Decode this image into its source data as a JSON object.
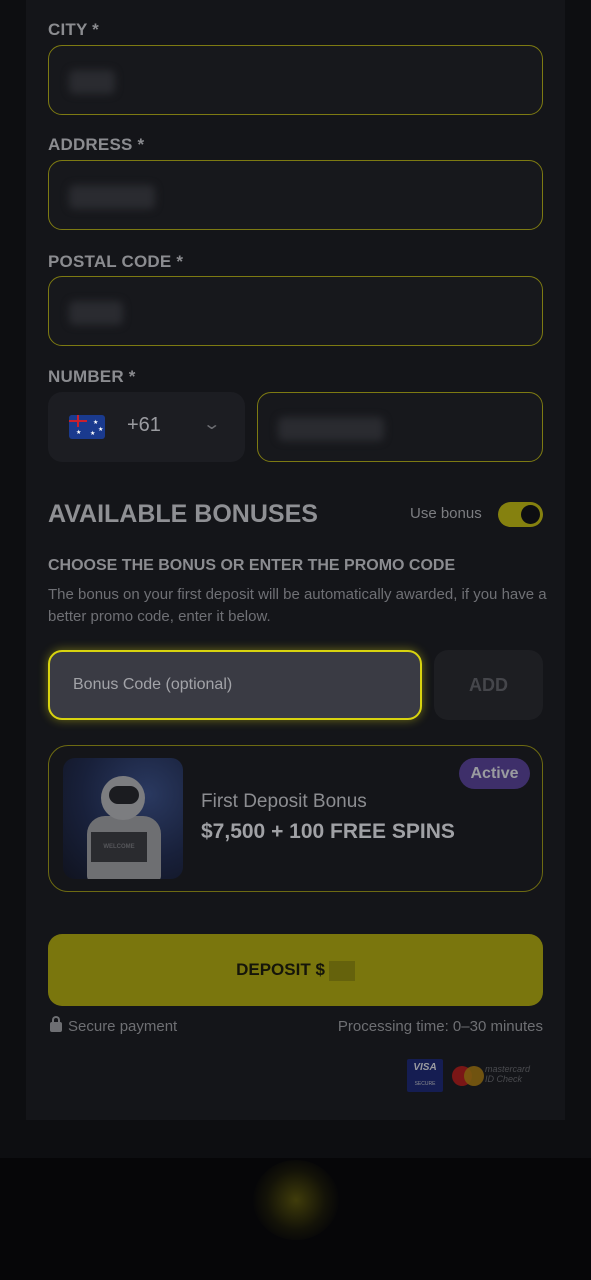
{
  "form": {
    "city_label": "CITY *",
    "address_label": "ADDRESS *",
    "postal_label": "POSTAL CODE *",
    "number_label": "NUMBER *",
    "phone_code": "+61"
  },
  "bonuses": {
    "title": "AVAILABLE BONUSES",
    "use_bonus_label": "Use bonus",
    "use_bonus_on": true,
    "choose_title": "CHOOSE THE BONUS OR ENTER THE PROMO CODE",
    "description": "The bonus on your first deposit will be automatically awarded, if you have a better promo code, enter it below.",
    "promo_placeholder": "Bonus Code (optional)",
    "add_label": "ADD",
    "card": {
      "badge": "Active",
      "name": "First Deposit Bonus",
      "value": "$7,500 + 100 FREE SPINS",
      "image_sign": "WELCOME"
    }
  },
  "deposit": {
    "button_label": "DEPOSIT  $",
    "secure_label": "Secure payment",
    "processing_label": "Processing time: 0–30 minutes",
    "visa_label": "VISA",
    "visa_sub": "SECURE",
    "mc_label_1": "mastercard",
    "mc_label_2": "ID Check"
  },
  "colors": {
    "accent": "#d8d30f",
    "background": "#0d0e11"
  }
}
